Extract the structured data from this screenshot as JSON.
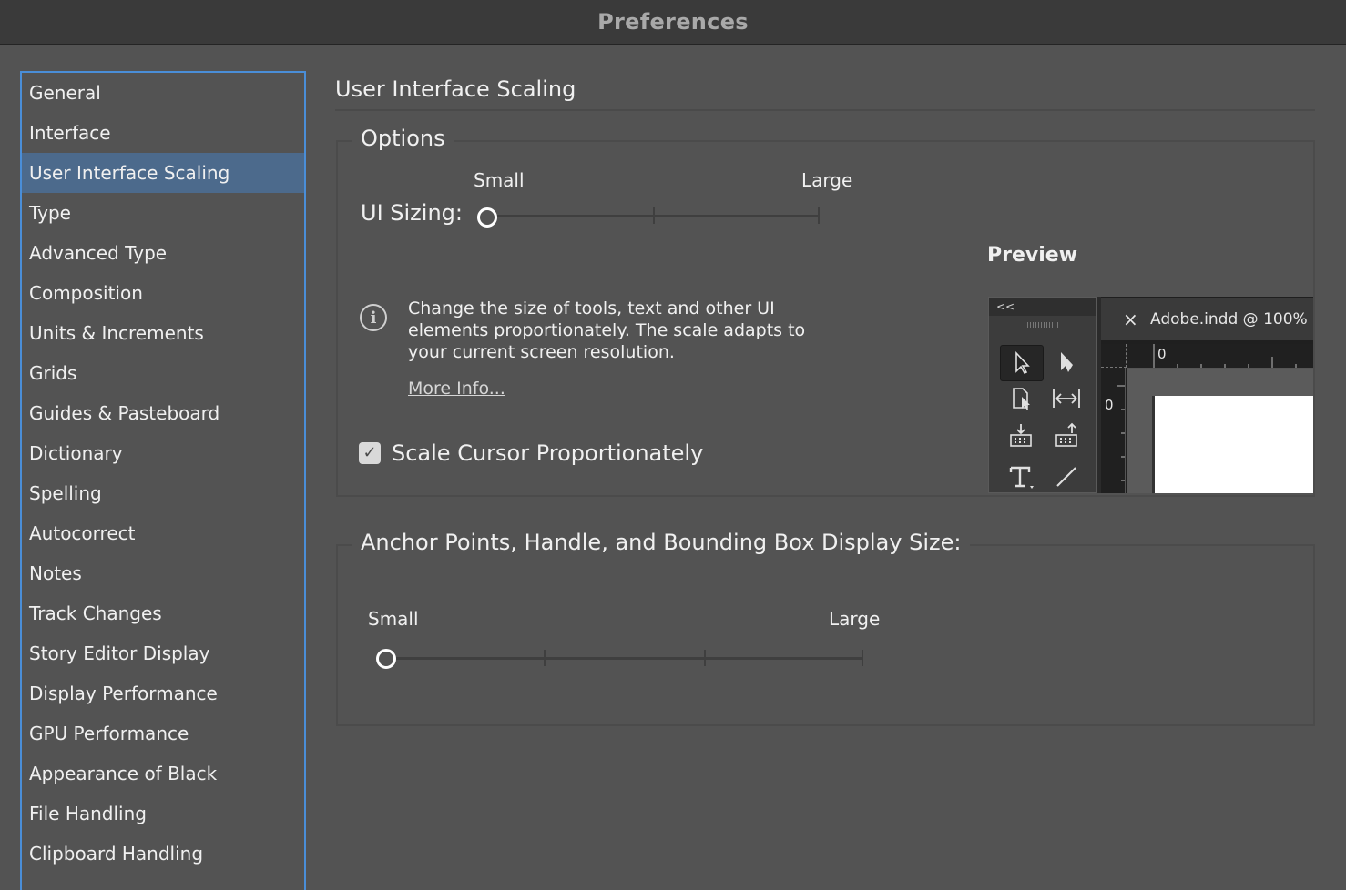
{
  "window": {
    "title": "Preferences"
  },
  "sidebar": {
    "items": [
      {
        "label": "General"
      },
      {
        "label": "Interface"
      },
      {
        "label": "User Interface Scaling",
        "selected": true
      },
      {
        "label": "Type"
      },
      {
        "label": "Advanced Type"
      },
      {
        "label": "Composition"
      },
      {
        "label": "Units & Increments"
      },
      {
        "label": "Grids"
      },
      {
        "label": "Guides & Pasteboard"
      },
      {
        "label": "Dictionary"
      },
      {
        "label": "Spelling"
      },
      {
        "label": "Autocorrect"
      },
      {
        "label": "Notes"
      },
      {
        "label": "Track Changes"
      },
      {
        "label": "Story Editor Display"
      },
      {
        "label": "Display Performance"
      },
      {
        "label": "GPU Performance"
      },
      {
        "label": "Appearance of Black"
      },
      {
        "label": "File Handling"
      },
      {
        "label": "Clipboard Handling"
      }
    ]
  },
  "main": {
    "title": "User Interface Scaling",
    "options": {
      "legend": "Options",
      "ui_sizing": {
        "label": "UI Sizing:",
        "min_label": "Small",
        "max_label": "Large",
        "value_step": 0,
        "steps": 3
      },
      "info_icon": "info-icon",
      "info_text": "Change the size of tools, text and other UI elements proportionately. The scale adapts to your current screen resolution.",
      "more_info": "More Info...",
      "scale_cursor": {
        "label": "Scale Cursor Proportionately",
        "checked": true
      },
      "preview": {
        "label": "Preview",
        "collapse_glyph": "<<",
        "tab_close": "×",
        "doc_name": "Adobe.indd @ 100% |",
        "ruler_h_zero": "0",
        "ruler_v_zero": "0"
      }
    },
    "anchor": {
      "legend": "Anchor Points, Handle, and Bounding Box Display Size:",
      "min_label": "Small",
      "max_label": "Large",
      "value_step": 0,
      "steps": 4
    }
  },
  "colors": {
    "background": "#535353",
    "selection": "#4c6a8c",
    "focus_border": "#4a8ed8"
  }
}
